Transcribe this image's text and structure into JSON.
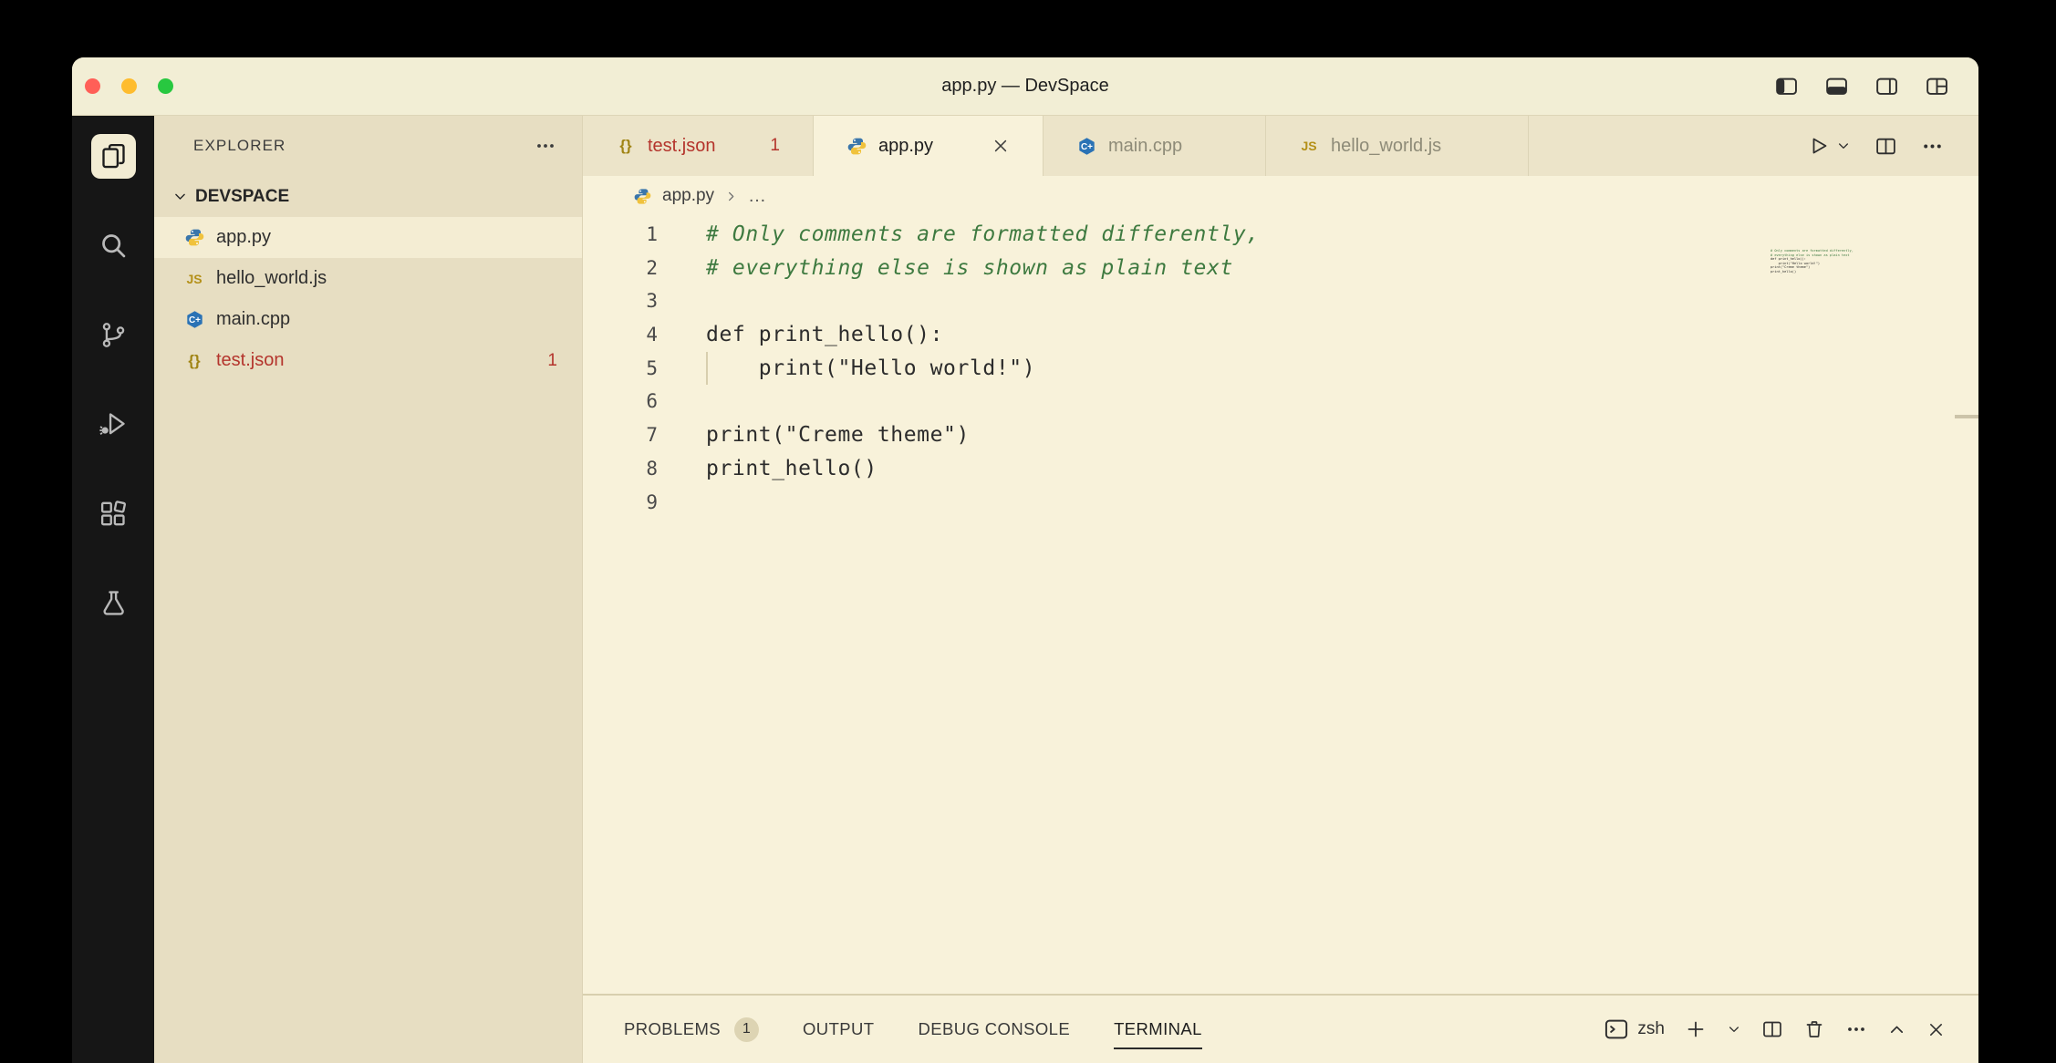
{
  "window": {
    "title": "app.py — DevSpace"
  },
  "icons": {
    "js_label": "JS",
    "json_label": "{}",
    "cpp_label": "C+"
  },
  "activity_bar": {
    "items": [
      "explorer",
      "search",
      "source-control",
      "run-and-debug",
      "extensions",
      "testing"
    ]
  },
  "sidebar": {
    "title": "EXPLORER",
    "section": "DEVSPACE",
    "files": [
      {
        "label": "app.py",
        "icon": "python"
      },
      {
        "label": "hello_world.js",
        "icon": "javascript"
      },
      {
        "label": "main.cpp",
        "icon": "cpp"
      },
      {
        "label": "test.json",
        "icon": "json",
        "badge": "1"
      }
    ]
  },
  "tabs": [
    {
      "label": "test.json",
      "badge": "1",
      "state": "modified"
    },
    {
      "label": "app.py",
      "state": "active"
    },
    {
      "label": "main.cpp",
      "state": "inactive"
    },
    {
      "label": "hello_world.js",
      "state": "inactive"
    }
  ],
  "breadcrumb": {
    "file": "app.py",
    "collapsed": "…"
  },
  "code": {
    "lines": [
      {
        "num": "1",
        "text": "# Only comments are formatted differently,",
        "kind": "comment"
      },
      {
        "num": "2",
        "text": "# everything else is shown as plain text",
        "kind": "comment"
      },
      {
        "num": "3",
        "text": "",
        "kind": "plain"
      },
      {
        "num": "4",
        "text": "def print_hello():",
        "kind": "plain"
      },
      {
        "num": "5",
        "text": "    print(\"Hello world!\")",
        "kind": "plain"
      },
      {
        "num": "6",
        "text": "",
        "kind": "plain"
      },
      {
        "num": "7",
        "text": "print(\"Creme theme\")",
        "kind": "plain"
      },
      {
        "num": "8",
        "text": "print_hello()",
        "kind": "plain"
      },
      {
        "num": "9",
        "text": "",
        "kind": "plain"
      }
    ]
  },
  "panel": {
    "tabs": [
      {
        "label": "PROBLEMS",
        "badge": "1"
      },
      {
        "label": "OUTPUT"
      },
      {
        "label": "DEBUG CONSOLE"
      },
      {
        "label": "TERMINAL",
        "active": true
      }
    ],
    "shell": "zsh"
  },
  "colors": {
    "titlebar_bg": "#f2eed5",
    "tabbar_bg": "#ece4c9",
    "editor_bg": "#f8f2da",
    "sidebar_bg": "#e7dec2",
    "panel_bg": "#f7f1d9",
    "activitybar_bg": "#161616",
    "comment_green": "#3e7a40",
    "error_red": "#b4342c",
    "selected_row": "#f4edd3",
    "traffic_red": "#ff5f57",
    "traffic_yellow": "#febc2e",
    "traffic_green": "#28c840",
    "python_blue": "#3a76ab",
    "python_yellow": "#f0c23c",
    "cpp_blue": "#2a72b5",
    "js_gold": "#b49018"
  }
}
